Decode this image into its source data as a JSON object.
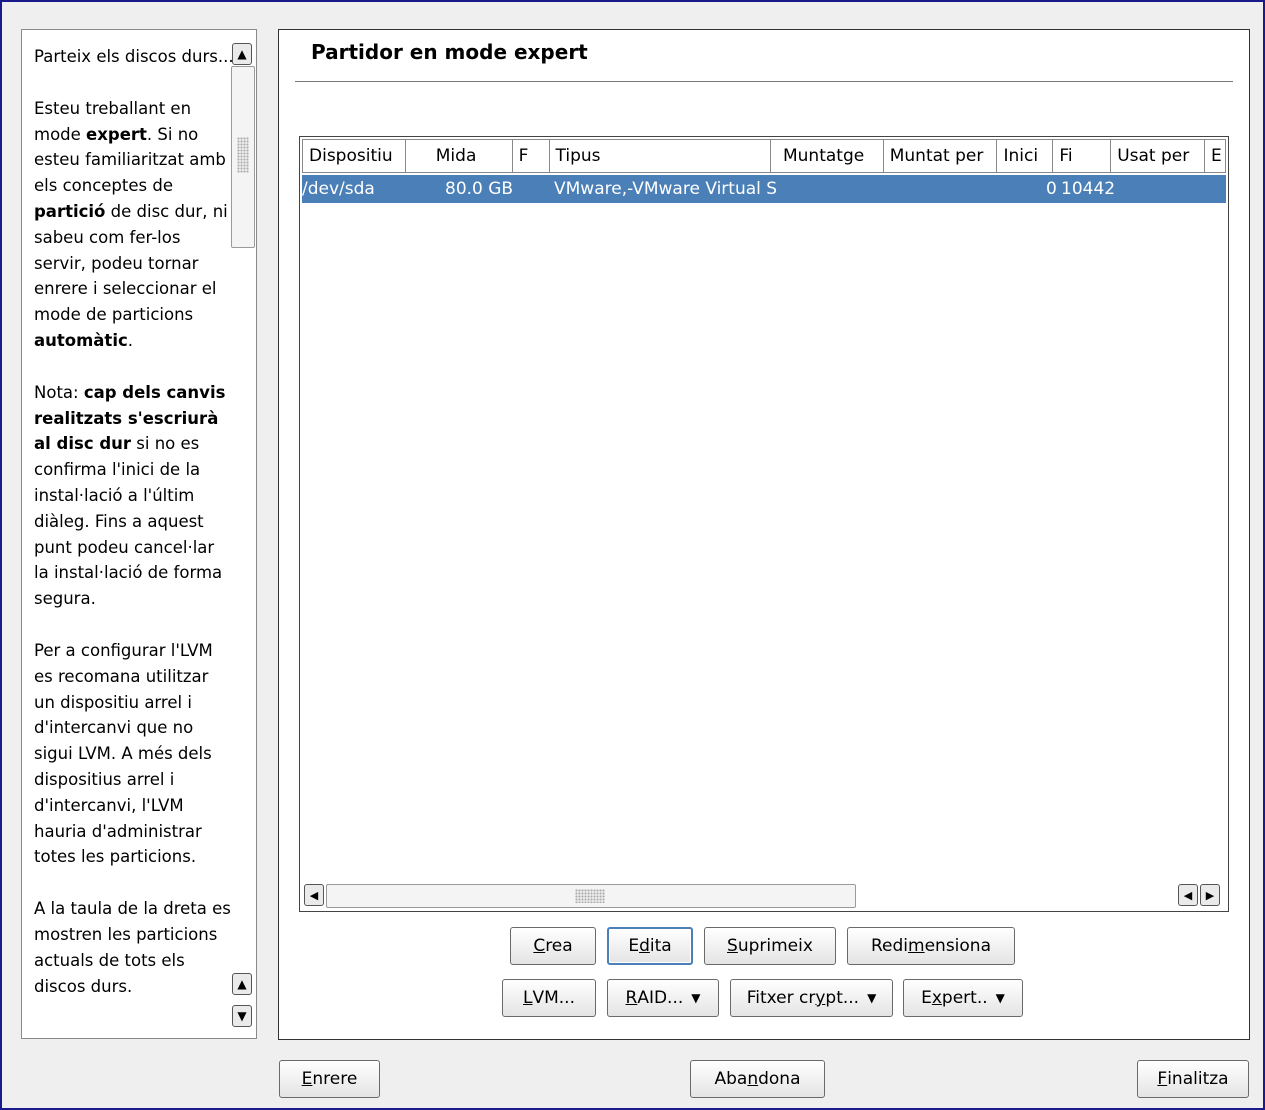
{
  "help": {
    "paragraphs": [
      [
        {
          "t": "Parteix els discos durs...",
          "b": false
        }
      ],
      [
        {
          "t": "Esteu treballant en mode ",
          "b": false
        },
        {
          "t": "expert",
          "b": true
        },
        {
          "t": ". Si no esteu familiaritzat amb els conceptes de ",
          "b": false
        },
        {
          "t": "partició",
          "b": true
        },
        {
          "t": " de disc dur, ni sabeu com fer-los servir, podeu tornar enrere i seleccionar el mode de particions ",
          "b": false
        },
        {
          "t": "automàtic",
          "b": true
        },
        {
          "t": ".",
          "b": false
        }
      ],
      [
        {
          "t": "Nota: ",
          "b": false
        },
        {
          "t": "cap dels canvis realitzats s'escriurà al disc dur",
          "b": true
        },
        {
          "t": " si no es confirma l'inici de la instal·lació a l'últim diàleg. Fins a aquest punt podeu cancel·lar la instal·lació de forma segura.",
          "b": false
        }
      ],
      [
        {
          "t": "Per a configurar l'LVM es recomana utilitzar un dispositiu arrel i d'intercanvi que no sigui LVM. A més dels dispositius arrel i d'intercanvi, l'LVM hauria d'administrar totes les particions.",
          "b": false
        }
      ],
      [
        {
          "t": "A la taula de la dreta es mostren les particions actuals de tots els discos durs.",
          "b": false
        }
      ]
    ]
  },
  "main": {
    "title": "Partidor en mode expert",
    "columns": [
      "Dispositiu",
      "Mida",
      "F",
      "Tipus",
      "Muntatge",
      "Muntat per",
      "Inici",
      "Fi",
      "Usat per",
      "E"
    ],
    "rows": [
      {
        "device": "/dev/sda",
        "size": "80.0 GB",
        "f": "",
        "type": "VMware,-VMware Virtual S",
        "mount": "",
        "mountby": "",
        "start": "0",
        "end": "10442",
        "usedby": ""
      }
    ]
  },
  "actions": {
    "row1": [
      {
        "pre": "",
        "u": "C",
        "post": "rea",
        "name": "create-button"
      },
      {
        "pre": "E",
        "u": "d",
        "post": "ita",
        "name": "edit-button"
      },
      {
        "pre": "",
        "u": "S",
        "post": "uprimeix",
        "name": "delete-button"
      },
      {
        "pre": "Redi",
        "u": "m",
        "post": "ensiona",
        "name": "resize-button"
      }
    ],
    "row2": [
      {
        "pre": "",
        "u": "L",
        "post": "VM...",
        "name": "lvm-button"
      },
      {
        "pre": "",
        "u": "R",
        "post": "AID...",
        "name": "raid-button"
      },
      {
        "pre": "Fitxer cr",
        "u": "y",
        "post": "pt...",
        "name": "crypt-file-button"
      },
      {
        "pre": "E",
        "u": "x",
        "post": "pert..",
        "name": "expert-button"
      }
    ]
  },
  "footer": {
    "back": {
      "pre": "",
      "u": "E",
      "post": "nrere"
    },
    "abort": {
      "pre": "Aba",
      "u": "n",
      "post": "dona"
    },
    "finish": {
      "pre": "",
      "u": "F",
      "post": "inalitza"
    }
  },
  "colors": {
    "selection": "#4a7fb8",
    "frame": "#1a1a8c"
  }
}
